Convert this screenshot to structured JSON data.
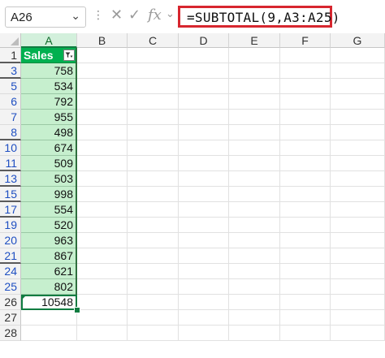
{
  "formula_bar": {
    "name_box": "A26",
    "formula": "=SUBTOTAL(9,A3:A25)",
    "icons": [
      "chevron-down-icon",
      "cancel-icon",
      "enter-check-icon",
      "insert-function-icon",
      "expand-chevron-icon"
    ],
    "highlight_color": "#d7262f"
  },
  "columns": [
    "A",
    "B",
    "C",
    "D",
    "E",
    "F",
    "G"
  ],
  "active_column": "A",
  "table": {
    "header_label": "Sales",
    "header_color": "#00b050",
    "fill_color": "#c6efce",
    "rows": [
      {
        "row": "1",
        "value": "Sales"
      },
      {
        "row": "3",
        "value": "758"
      },
      {
        "row": "5",
        "value": "534"
      },
      {
        "row": "6",
        "value": "792"
      },
      {
        "row": "7",
        "value": "955"
      },
      {
        "row": "8",
        "value": "498"
      },
      {
        "row": "10",
        "value": "674"
      },
      {
        "row": "11",
        "value": "509"
      },
      {
        "row": "13",
        "value": "503"
      },
      {
        "row": "15",
        "value": "998"
      },
      {
        "row": "17",
        "value": "554"
      },
      {
        "row": "19",
        "value": "520"
      },
      {
        "row": "20",
        "value": "963"
      },
      {
        "row": "21",
        "value": "867"
      },
      {
        "row": "24",
        "value": "621"
      },
      {
        "row": "25",
        "value": "802"
      },
      {
        "row": "26",
        "value": "10548"
      },
      {
        "row": "27",
        "value": ""
      },
      {
        "row": "28",
        "value": ""
      }
    ]
  }
}
